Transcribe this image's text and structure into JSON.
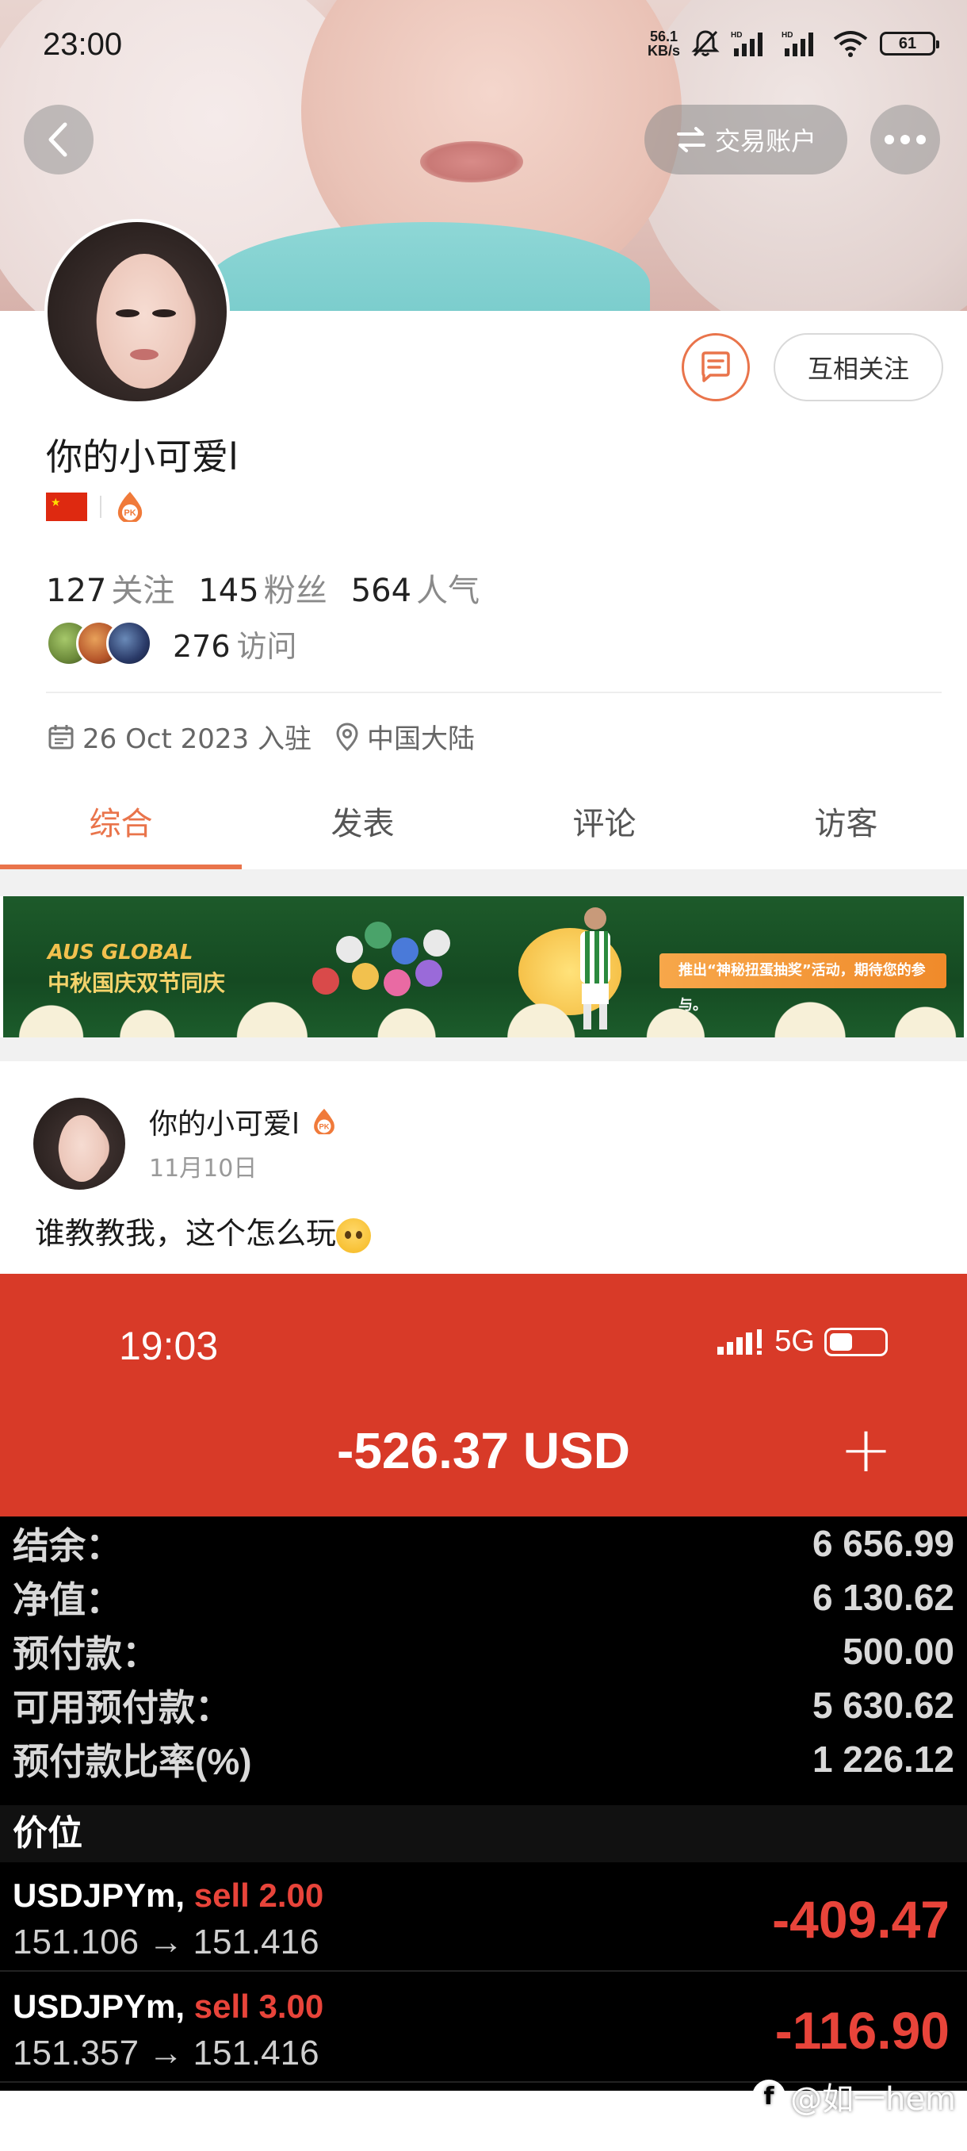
{
  "status_bar": {
    "time": "23:00",
    "net_speed_value": "56.1",
    "net_speed_unit": "KB/s",
    "battery": "61",
    "icons": [
      "mute-bell-icon",
      "signal-hd-icon",
      "signal-hd-icon",
      "wifi-icon",
      "battery-icon"
    ]
  },
  "header": {
    "trade_account_label": "交易账户"
  },
  "profile": {
    "follow_button_label": "互相关注",
    "username": "你的小可爱l",
    "pk_badge": "PK",
    "stats": [
      {
        "num": "127",
        "label": "关注"
      },
      {
        "num": "145",
        "label": "粉丝"
      },
      {
        "num": "564",
        "label": "人气"
      }
    ],
    "visits_num": "276",
    "visits_label": "访问",
    "joined_date": "26 Oct 2023 入驻",
    "location": "中国大陆"
  },
  "tabs": [
    {
      "label": "综合",
      "active": true
    },
    {
      "label": "发表",
      "active": false
    },
    {
      "label": "评论",
      "active": false
    },
    {
      "label": "访客",
      "active": false
    }
  ],
  "banner": {
    "brand": "AUS GLOBAL",
    "title": "中秋国庆双节同庆",
    "tagline": "推出“神秘扭蛋抽奖”活动，期待您的参与。"
  },
  "post": {
    "author": "你的小可爱l",
    "date": "11月10日",
    "text": "谁教教我，这个怎么玩"
  },
  "embedded_screenshot": {
    "time": "19:03",
    "network": "5G",
    "total": "-526.37 USD",
    "plus": "+",
    "account_rows": [
      {
        "label": "结余：",
        "value": "6 656.99"
      },
      {
        "label": "净值：",
        "value": "6 130.62"
      },
      {
        "label": "预付款：",
        "value": "500.00"
      },
      {
        "label": "可用预付款：",
        "value": "5 630.62"
      },
      {
        "label": "预付款比率(%)",
        "value": "1 226.12"
      }
    ],
    "price_header": "价位",
    "positions": [
      {
        "symbol": "USDJPYm,",
        "side": "sell 2.00",
        "prices": "151.106 → 151.416",
        "pl": "-409.47"
      },
      {
        "symbol": "USDJPYm,",
        "side": "sell 3.00",
        "prices": "151.357 → 151.416",
        "pl": "-116.90"
      }
    ]
  },
  "watermark": "@如一hem",
  "colors": {
    "accent": "#e9744b",
    "header_red": "#d83a28",
    "loss_red": "#e8443a"
  }
}
